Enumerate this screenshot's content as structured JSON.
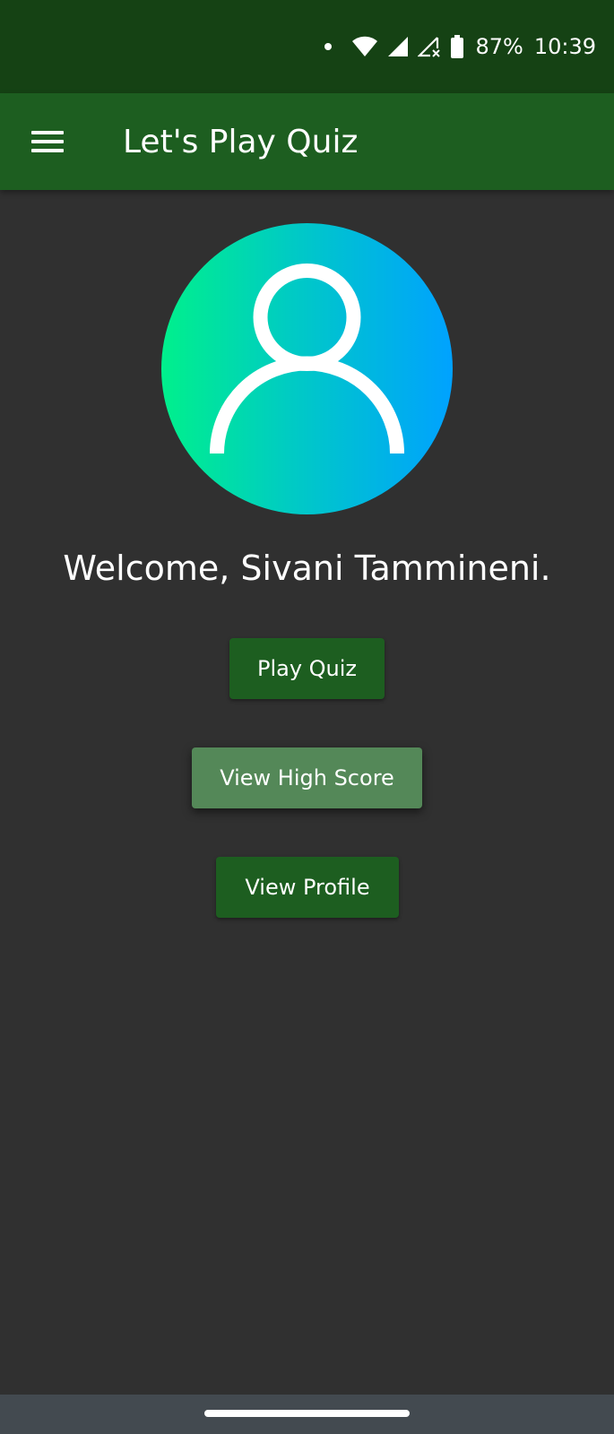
{
  "status_bar": {
    "battery_percent": "87%",
    "time": "10:39",
    "icons": [
      "notification-dot-icon",
      "wifi-icon",
      "cell-signal-icon",
      "cell-signal-no-data-icon",
      "battery-icon"
    ]
  },
  "app_bar": {
    "title": "Let's Play Quiz",
    "menu_icon": "hamburger-menu-icon",
    "color": "#1d5e20"
  },
  "profile": {
    "avatar_icon": "user-icon",
    "welcome_text": "Welcome, Sivani Tammineni."
  },
  "actions": {
    "play_quiz": "Play Quiz",
    "view_high_score": "View High Score",
    "view_profile": "View Profile"
  },
  "colors": {
    "background": "#303030",
    "status_bar": "#154214",
    "primary_button": "#1d5e20",
    "highlighted_button": "#548858",
    "avatar_gradient": [
      "#00f08c",
      "#00a2ff"
    ]
  }
}
